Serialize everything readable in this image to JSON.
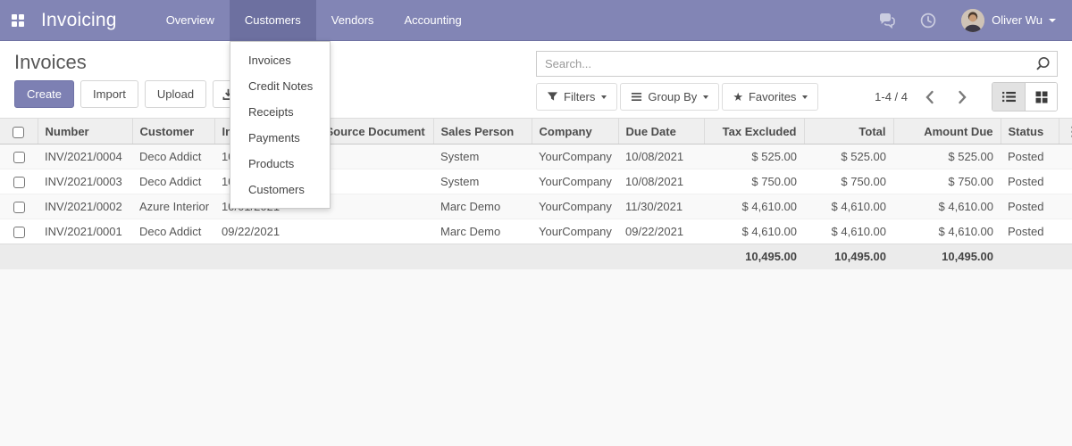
{
  "brand": "Invoicing",
  "nav": {
    "items": [
      {
        "label": "Overview"
      },
      {
        "label": "Customers"
      },
      {
        "label": "Vendors"
      },
      {
        "label": "Accounting"
      }
    ],
    "user": "Oliver Wu"
  },
  "customers_menu": {
    "items": [
      "Invoices",
      "Credit Notes",
      "Receipts",
      "Payments",
      "Products",
      "Customers"
    ]
  },
  "page": {
    "title": "Invoices",
    "create_label": "Create",
    "import_label": "Import",
    "upload_label": "Upload"
  },
  "search": {
    "placeholder": "Search..."
  },
  "toolbar": {
    "filters_label": "Filters",
    "group_by_label": "Group By",
    "favorites_label": "Favorites",
    "pager": "1-4 / 4"
  },
  "icons": {
    "favorites_star": "★",
    "column_options": "⋮"
  },
  "table": {
    "columns": [
      "Number",
      "Customer",
      "Invoice Date",
      "Source Document",
      "Sales Person",
      "Company",
      "Due Date",
      "Tax Excluded",
      "Total",
      "Amount Due",
      "Status"
    ],
    "rows": [
      {
        "number": "INV/2021/0004",
        "customer": "Deco Addict",
        "invoice_date": "10/08/2021",
        "source_document": "",
        "sales_person": "System",
        "company": "YourCompany",
        "due_date": "10/08/2021",
        "tax_excluded": "$ 525.00",
        "total": "$ 525.00",
        "amount_due": "$ 525.00",
        "status": "Posted"
      },
      {
        "number": "INV/2021/0003",
        "customer": "Deco Addict",
        "invoice_date": "10/08/2021",
        "source_document": "",
        "sales_person": "System",
        "company": "YourCompany",
        "due_date": "10/08/2021",
        "tax_excluded": "$ 750.00",
        "total": "$ 750.00",
        "amount_due": "$ 750.00",
        "status": "Posted"
      },
      {
        "number": "INV/2021/0002",
        "customer": "Azure Interior",
        "invoice_date": "10/01/2021",
        "source_document": "",
        "sales_person": "Marc Demo",
        "company": "YourCompany",
        "due_date": "11/30/2021",
        "tax_excluded": "$ 4,610.00",
        "total": "$ 4,610.00",
        "amount_due": "$ 4,610.00",
        "status": "Posted"
      },
      {
        "number": "INV/2021/0001",
        "customer": "Deco Addict",
        "invoice_date": "09/22/2021",
        "source_document": "",
        "sales_person": "Marc Demo",
        "company": "YourCompany",
        "due_date": "09/22/2021",
        "tax_excluded": "$ 4,610.00",
        "total": "$ 4,610.00",
        "amount_due": "$ 4,610.00",
        "status": "Posted"
      }
    ],
    "totals": {
      "tax_excluded": "10,495.00",
      "total": "10,495.00",
      "amount_due": "10,495.00"
    }
  },
  "colors": {
    "navbar": "#8285b5",
    "navbar_active": "#6d70a0",
    "primary_button": "#7d80b3",
    "footer_row": "#ebebeb"
  }
}
